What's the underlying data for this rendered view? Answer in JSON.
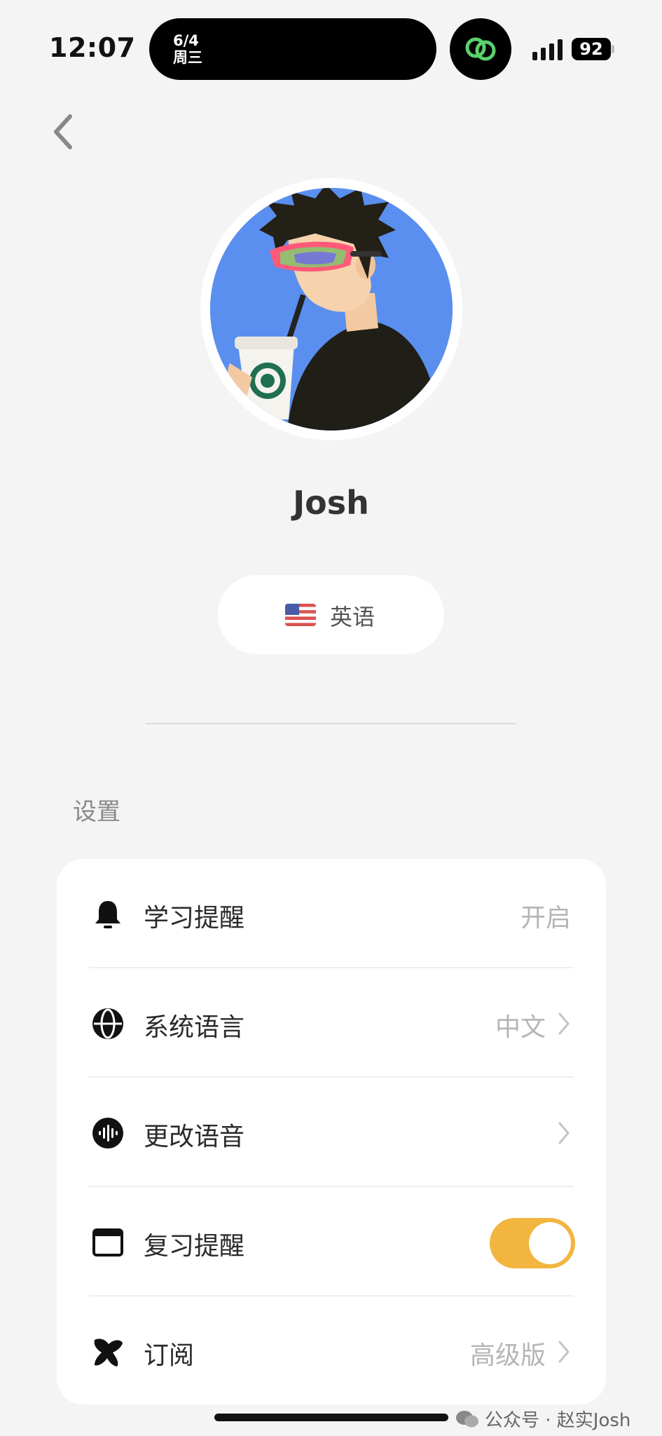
{
  "status_bar": {
    "time": "12:07",
    "island_date": "6/4",
    "island_weekday": "周三",
    "battery": "92"
  },
  "profile": {
    "name": "Josh",
    "language": "英语",
    "flag_icon": "us-flag-icon"
  },
  "settings": {
    "title": "设置",
    "items": [
      {
        "label": "学习提醒",
        "value": "开启",
        "icon": "bell-icon"
      },
      {
        "label": "系统语言",
        "value": "中文",
        "icon": "globe-icon"
      },
      {
        "label": "更改语音",
        "value": "",
        "icon": "voice-icon"
      },
      {
        "label": "复习提醒",
        "toggle_on": true,
        "icon": "window-icon"
      },
      {
        "label": "订阅",
        "value": "高级版",
        "icon": "star-icon"
      }
    ]
  },
  "watermark": "公众号 · 赵实Josh",
  "colors": {
    "background": "#f4f4f4",
    "toggle_on": "#f1b540",
    "avatar_bg": "#5a8fef"
  }
}
